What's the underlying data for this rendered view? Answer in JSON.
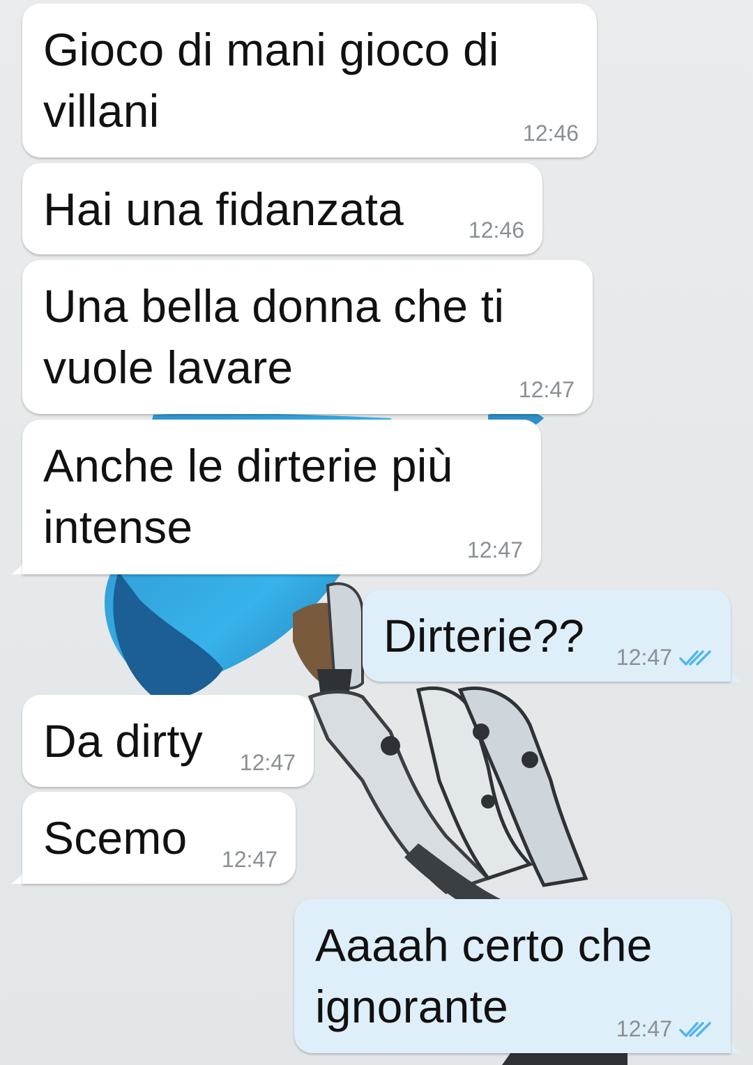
{
  "conversation": {
    "messages": [
      {
        "id": "m1",
        "direction": "incoming",
        "text": "Gioco di mani gioco di villani",
        "lines": [
          "Gioco di mani gioco di",
          "villani"
        ],
        "time": "12:46"
      },
      {
        "id": "m2",
        "direction": "incoming",
        "text": "Hai una fidanzata",
        "lines": [
          "Hai una fidanzata"
        ],
        "time": "12:46"
      },
      {
        "id": "m3",
        "direction": "incoming",
        "text": "Una bella donna che ti vuole lavare",
        "lines": [
          "Una bella donna che ti",
          "vuole lavare"
        ],
        "time": "12:47"
      },
      {
        "id": "m4",
        "direction": "incoming",
        "text": "Anche le dirterie più intense",
        "lines": [
          "Anche le dirterie più",
          "intense"
        ],
        "time": "12:47"
      },
      {
        "id": "m5",
        "direction": "outgoing",
        "text": "Dirterie??",
        "lines": [
          "Dirterie??"
        ],
        "time": "12:47",
        "status": "read"
      },
      {
        "id": "m6",
        "direction": "incoming",
        "text": "Da dirty",
        "lines": [
          "Da dirty"
        ],
        "time": "12:47"
      },
      {
        "id": "m7",
        "direction": "incoming",
        "text": "Scemo",
        "lines": [
          "Scemo"
        ],
        "time": "12:47"
      },
      {
        "id": "m8",
        "direction": "outgoing",
        "text": "Aaaah certo che ignorante",
        "lines": [
          "Aaaah certo che",
          "ignorante"
        ],
        "time": "12:47",
        "status": "read"
      }
    ]
  },
  "icons": {
    "read_receipt": "double-check-icon"
  },
  "colors": {
    "incoming_bubble": "#ffffff",
    "outgoing_bubble": "#dfeffa",
    "read_ticks": "#4fb6ec",
    "timestamp": "#8a8f93",
    "wallpaper": "#e7e9ea"
  }
}
